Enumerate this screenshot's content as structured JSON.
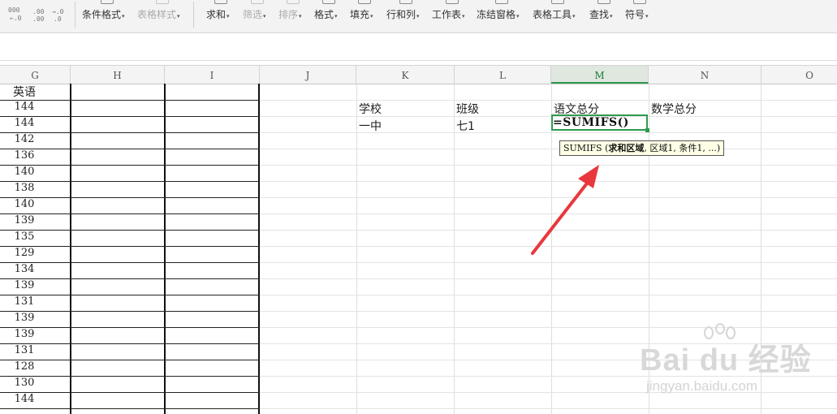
{
  "ribbon": {
    "number_format_glyphs": [
      "000",
      "←.0",
      ".00",
      ".00",
      "→.0",
      ".0"
    ],
    "items": [
      {
        "label": "条件格式",
        "enabled": true
      },
      {
        "label": "表格样式",
        "enabled": false
      },
      {
        "label": "求和",
        "enabled": true
      },
      {
        "label": "筛选",
        "enabled": false
      },
      {
        "label": "排序",
        "enabled": false
      },
      {
        "label": "格式",
        "enabled": true
      },
      {
        "label": "填充",
        "enabled": true
      },
      {
        "label": "行和列",
        "enabled": true
      },
      {
        "label": "工作表",
        "enabled": true
      },
      {
        "label": "冻结窗格",
        "enabled": true
      },
      {
        "label": "表格工具",
        "enabled": true
      },
      {
        "label": "查找",
        "enabled": true
      },
      {
        "label": "符号",
        "enabled": true
      }
    ]
  },
  "columns": [
    "G",
    "H",
    "I",
    "J",
    "K",
    "L",
    "M",
    "N",
    "O"
  ],
  "active_column": "M",
  "sheet": {
    "g_header": "英语",
    "g_values": [
      "144",
      "144",
      "142",
      "136",
      "140",
      "138",
      "140",
      "139",
      "135",
      "129",
      "134",
      "139",
      "131",
      "139",
      "139",
      "131",
      "128",
      "130",
      "144"
    ],
    "k_header": "学校",
    "l_header": "班级",
    "m_header": "语文总分",
    "n_header": "数学总分",
    "k_value": "一中",
    "l_value": "七1",
    "m_formula": "=SUMIFS()"
  },
  "tooltip": {
    "prefix": "SUMIFS (",
    "bold_arg": "求和区域",
    "rest": ", 区域1, 条件1, ...)"
  },
  "watermark": {
    "brand": "Bai du 经验",
    "url": "jingyan.baidu.com"
  },
  "colors": {
    "accent": "#2e9b4f",
    "arrow": "#e8383c",
    "tooltip_bg": "#ffffe6"
  }
}
